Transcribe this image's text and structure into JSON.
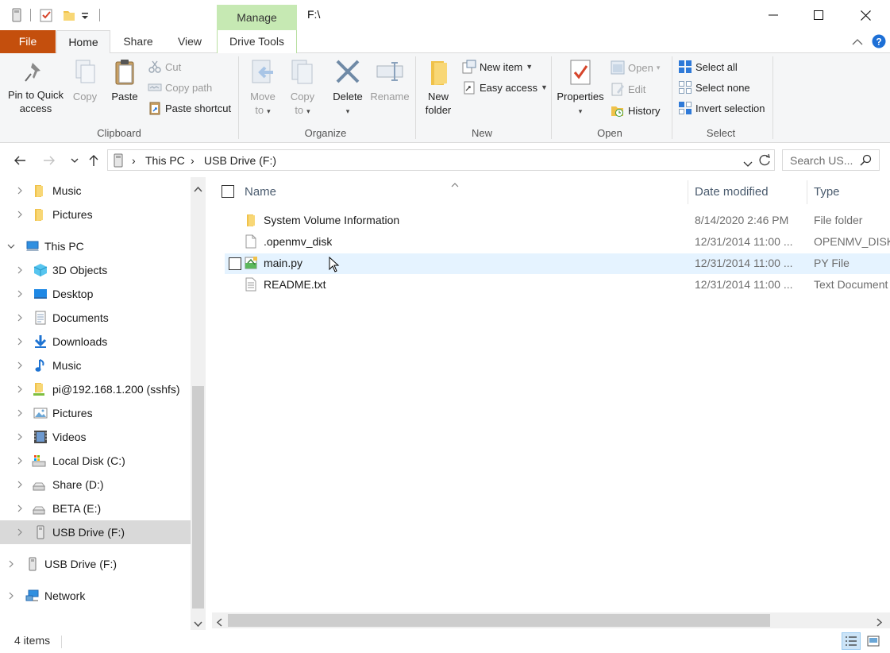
{
  "window": {
    "context_tab": "Manage",
    "title": "F:\\"
  },
  "tabs": [
    {
      "label": "File"
    },
    {
      "label": "Home"
    },
    {
      "label": "Share"
    },
    {
      "label": "View"
    },
    {
      "label": "Drive Tools"
    }
  ],
  "ribbon": {
    "clipboard": {
      "label": "Clipboard",
      "pin_line1": "Pin to Quick",
      "pin_line2": "access",
      "copy": "Copy",
      "paste": "Paste",
      "cut": "Cut",
      "copy_path": "Copy path",
      "paste_shortcut": "Paste shortcut"
    },
    "organize": {
      "label": "Organize",
      "move_line1": "Move",
      "move_line2": "to",
      "copy_line1": "Copy",
      "copy_line2": "to",
      "delete": "Delete",
      "rename": "Rename"
    },
    "new": {
      "label": "New",
      "new_folder_line1": "New",
      "new_folder_line2": "folder",
      "new_item": "New item",
      "easy_access": "Easy access"
    },
    "open": {
      "label": "Open",
      "properties": "Properties",
      "open": "Open",
      "edit": "Edit",
      "history": "History"
    },
    "select": {
      "label": "Select",
      "select_all": "Select all",
      "select_none": "Select none",
      "invert": "Invert selection"
    }
  },
  "address": {
    "crumbs": [
      "This PC",
      "USB Drive (F:)"
    ],
    "search_placeholder": "Search US..."
  },
  "nav": {
    "items": [
      {
        "label": "Music"
      },
      {
        "label": "Pictures"
      },
      {
        "label": "This PC"
      },
      {
        "label": "3D Objects"
      },
      {
        "label": "Desktop"
      },
      {
        "label": "Documents"
      },
      {
        "label": "Downloads"
      },
      {
        "label": "Music"
      },
      {
        "label": "pi@192.168.1.200 (sshfs)"
      },
      {
        "label": "Pictures"
      },
      {
        "label": "Videos"
      },
      {
        "label": "Local Disk (C:)"
      },
      {
        "label": "Share (D:)"
      },
      {
        "label": "BETA (E:)"
      },
      {
        "label": "USB Drive (F:)"
      },
      {
        "label": "USB Drive (F:)"
      },
      {
        "label": "Network"
      }
    ]
  },
  "files": {
    "headers": {
      "name": "Name",
      "date": "Date modified",
      "type": "Type"
    },
    "rows": [
      {
        "name": "System Volume Information",
        "date": "8/14/2020 2:46 PM",
        "type": "File folder"
      },
      {
        "name": ".openmv_disk",
        "date": "12/31/2014 11:00 ...",
        "type": "OPENMV_DISK"
      },
      {
        "name": "main.py",
        "date": "12/31/2014 11:00 ...",
        "type": "PY File"
      },
      {
        "name": "README.txt",
        "date": "12/31/2014 11:00 ...",
        "type": "Text Document"
      }
    ]
  },
  "status": {
    "count": "4 items"
  },
  "colors": {
    "file_tab": "#c44f0d",
    "manage_tab": "#c6e9b3",
    "hover_row": "#e5f3ff",
    "selected_nav": "#d9d9d9"
  }
}
